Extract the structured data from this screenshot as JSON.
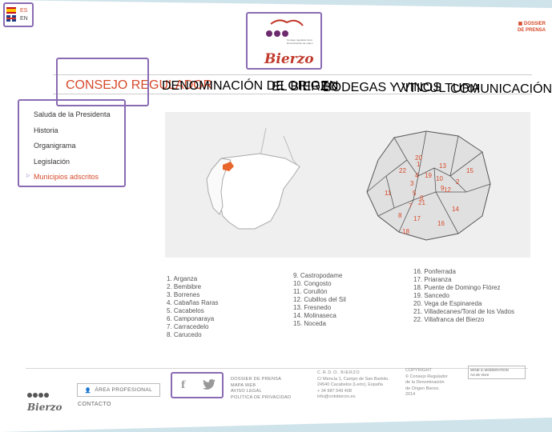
{
  "lang": {
    "es": "ES",
    "en": "EN"
  },
  "logo": {
    "small_text": "Consejo regulador de la Denominación de origen",
    "word": "Bierzo"
  },
  "dossier": {
    "line1": "DOSSIER",
    "line2": "DE PRENSA"
  },
  "nav": [
    {
      "label": "CONSEJO REGULADOR",
      "active": true
    },
    {
      "label": "DENOMINACIÓN DE ORIGEN"
    },
    {
      "label": "EL BIERZO"
    },
    {
      "label": "BODEGAS Y VINOS"
    },
    {
      "label": "VITICULTURA"
    },
    {
      "label": "COMUNICACIÓN"
    }
  ],
  "sidemenu": [
    {
      "label": "Saluda de la Presidenta"
    },
    {
      "label": "Historia"
    },
    {
      "label": "Organigrama"
    },
    {
      "label": "Legislación"
    },
    {
      "label": "Municipios adscritos",
      "active": true
    }
  ],
  "map": {
    "numbers": [
      "1",
      "2",
      "3",
      "4",
      "5",
      "6",
      "7",
      "8",
      "9",
      "10",
      "11",
      "12",
      "13",
      "14",
      "15",
      "16",
      "17",
      "18",
      "19",
      "20",
      "21",
      "22"
    ]
  },
  "municipios": [
    [
      "1. Arganza",
      "2. Bembibre",
      "3. Borrenes",
      "4. Cabañas Raras",
      "5. Cacabelos",
      "6. Camponaraya",
      "7. Carracedelo",
      "8. Carucedo"
    ],
    [
      "9. Castropodame",
      "10. Congosto",
      "11. Corullón",
      "12. Cubillos del Sil",
      "13. Fresnedo",
      "14. Molinaseca",
      "15. Noceda"
    ],
    [
      "16. Ponferrada",
      "17. Priaranza",
      "18. Puente de Domingo Flórez",
      "19. Sancedo",
      "20. Vega de Espinareda",
      "21. Villadecanes/Toral de los Vados",
      "22. Villafranca del Bierzo"
    ]
  ],
  "footer": {
    "logo_word": "Bierzo",
    "area_profesional": "ÁREA PROFESIONAL",
    "contacto": "CONTACTO",
    "links": [
      "DOSSIER DE PRENSA",
      "MAPA WEB",
      "AVISO LEGAL",
      "POLÍTICA DE PRIVACIDAD"
    ],
    "address": [
      "C.R.D.O. BIERZO",
      "C/ Mencía 1, Campo de San Bartolo.",
      "24540 Cacabelos (León), España",
      "+ 34 987 549 408",
      "info@crdobierzo.es"
    ],
    "copyright": [
      "COPYRIGHT",
      "© Consejo Regulador",
      "de la Denominación",
      "de Origen Bierzo.",
      "2014"
    ],
    "wim": [
      "WINE in MODERATION",
      "Art de Vivre"
    ]
  },
  "colors": {
    "accent": "#d64a2b",
    "highlight": "#8a6bb3",
    "map_panel": "#efefef"
  }
}
